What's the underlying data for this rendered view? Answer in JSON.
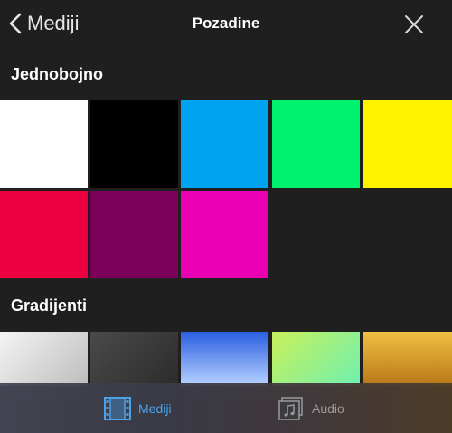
{
  "header": {
    "back_label": "Mediji",
    "title": "Pozadine"
  },
  "sections": {
    "solid": {
      "heading": "Jednobojno",
      "swatches": [
        {
          "name": "white",
          "color": "#ffffff"
        },
        {
          "name": "black",
          "color": "#000000"
        },
        {
          "name": "blue",
          "color": "#00a3f0"
        },
        {
          "name": "green",
          "color": "#00f26e"
        },
        {
          "name": "yellow",
          "color": "#fff200"
        },
        {
          "name": "red",
          "color": "#ee0040"
        },
        {
          "name": "purple",
          "color": "#7c005a"
        },
        {
          "name": "magenta",
          "color": "#ec00b4"
        }
      ]
    },
    "gradient": {
      "heading": "Gradijenti",
      "swatches": [
        {
          "name": "silver",
          "from": "#f4f4f4",
          "to": "#bdbdbd"
        },
        {
          "name": "charcoal",
          "from": "#4a4a4a",
          "to": "#2c2c2c"
        },
        {
          "name": "sky-blue",
          "from": "#2a5fe0",
          "to": "#b8d2ff"
        },
        {
          "name": "lime-mint",
          "from": "#c9f05a",
          "to": "#6ff0b0"
        },
        {
          "name": "gold",
          "from": "#f0c040",
          "to": "#b8761a"
        }
      ]
    }
  },
  "tabbar": {
    "tabs": [
      {
        "label": "Mediji",
        "icon": "film-icon",
        "active": true
      },
      {
        "label": "Audio",
        "icon": "music-note-icon",
        "active": false
      }
    ]
  },
  "colors": {
    "accent": "#4aa3ea",
    "inactive": "#9a9a9a",
    "background": "#1f1f1f"
  }
}
